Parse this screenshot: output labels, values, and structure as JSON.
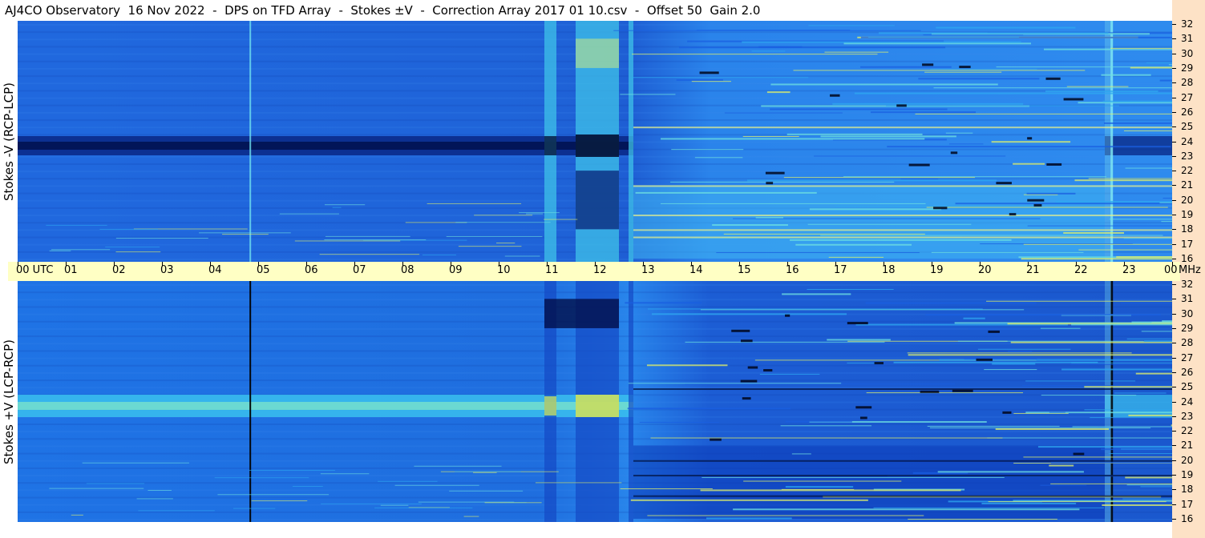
{
  "title": "AJ4CO Observatory  16 Nov 2022  -  DPS on TFD Array  -  Stokes ±V  -  Correction Array 2017 01 10.csv  -  Offset 50  Gain 2.0",
  "colors": {
    "title_bg": "#ffffff",
    "time_axis_bg": "#ffffc4",
    "freq_axis_bg": "#fde2c6",
    "colormap": [
      "#000033",
      "#0022a0",
      "#1a5fe0",
      "#2fa8f0",
      "#6ee0e0",
      "#e0f06a",
      "#ff3030"
    ]
  },
  "chart_data": [
    {
      "type": "heatmap",
      "panel": "top",
      "ylabel": "Stokes -V (RCP-LCP)",
      "x_tick_labels": [
        "00 UTC",
        "01",
        "02",
        "03",
        "04",
        "05",
        "06",
        "07",
        "08",
        "09",
        "10",
        "11",
        "12",
        "13",
        "14",
        "15",
        "16",
        "17",
        "18",
        "19",
        "20",
        "21",
        "22",
        "23",
        "00"
      ],
      "x_unit_label": "MHz",
      "y_tick_labels": [
        "32",
        "31",
        "30",
        "29",
        "28",
        "27",
        "26",
        "25",
        "24",
        "23",
        "22",
        "21",
        "20",
        "19",
        "18",
        "17",
        "16"
      ],
      "x_range_hours": [
        0,
        24
      ],
      "y_range_mhz": [
        16,
        32
      ],
      "dark_band_mhz": 23.7,
      "bright_burst_hours": [
        [
          11.5,
          12.5
        ]
      ],
      "interference_from_hour": 12.8
    },
    {
      "type": "heatmap",
      "panel": "bottom",
      "ylabel": "Stokes +V (LCP-RCP)",
      "y_tick_labels": [
        "32",
        "31",
        "30",
        "29",
        "28",
        "27",
        "26",
        "25",
        "24",
        "23",
        "22",
        "21",
        "20",
        "19",
        "18",
        "17",
        "16"
      ],
      "x_range_hours": [
        0,
        24
      ],
      "y_range_mhz": [
        16,
        32
      ],
      "bright_band_mhz": 23.7,
      "dark_burst_hours": [
        [
          11.5,
          12.5
        ]
      ],
      "interference_from_hour": 12.8
    }
  ]
}
